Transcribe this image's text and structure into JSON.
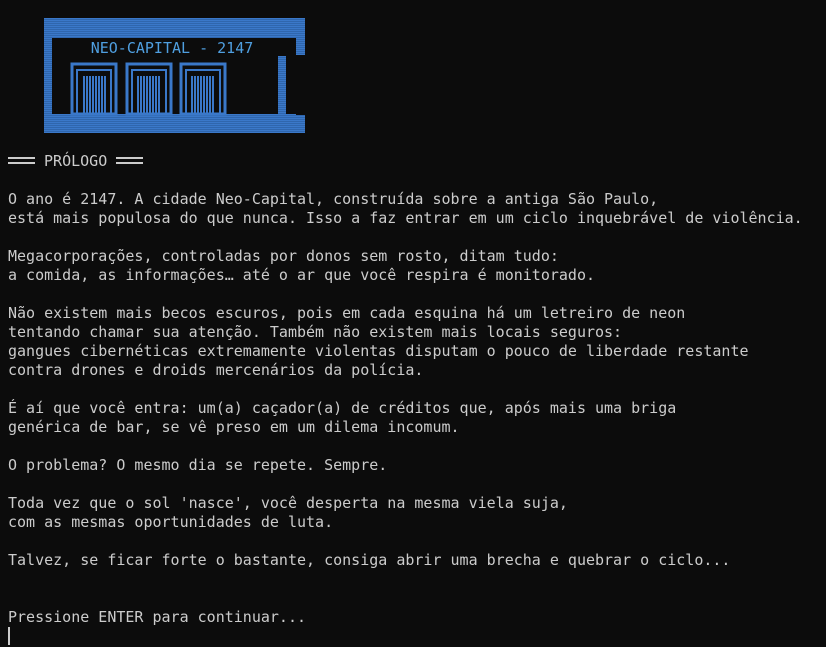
{
  "banner": {
    "title": "NEO-CAPITAL - 2147",
    "color": "#3a78c9"
  },
  "heading": {
    "label": "PRÓLOGO"
  },
  "story": {
    "p1_l1": "O ano é 2147. A cidade Neo-Capital, construída sobre a antiga São Paulo,",
    "p1_l2": "está mais populosa do que nunca. Isso a faz entrar em um ciclo inquebrável de violência.",
    "p2_l1": "Megacorporações, controladas por donos sem rosto, ditam tudo:",
    "p2_l2": "a comida, as informações… até o ar que você respira é monitorado.",
    "p3_l1": "Não existem mais becos escuros, pois em cada esquina há um letreiro de neon",
    "p3_l2": "tentando chamar sua atenção. Também não existem mais locais seguros:",
    "p3_l3": "gangues cibernéticas extremamente violentas disputam o pouco de liberdade restante",
    "p3_l4": "contra drones e droids mercenários da polícia.",
    "p4_l1": "É aí que você entra: um(a) caçador(a) de créditos que, após mais uma briga",
    "p4_l2": "genérica de bar, se vê preso em um dilema incomum.",
    "p5_l1": "O problema? O mesmo dia se repete. Sempre.",
    "p6_l1": "Toda vez que o sol 'nasce', você desperta na mesma viela suja,",
    "p6_l2": "com as mesmas oportunidades de luta.",
    "p7_l1": "Talvez, se ficar forte o bastante, consiga abrir uma brecha e quebrar o ciclo..."
  },
  "prompt": {
    "label": "Pressione ENTER para continuar..."
  },
  "colors": {
    "background": "#0c0c0c",
    "text": "#cccccc",
    "banner_fill": "#3a78c9",
    "banner_text": "#4f9fe0"
  }
}
